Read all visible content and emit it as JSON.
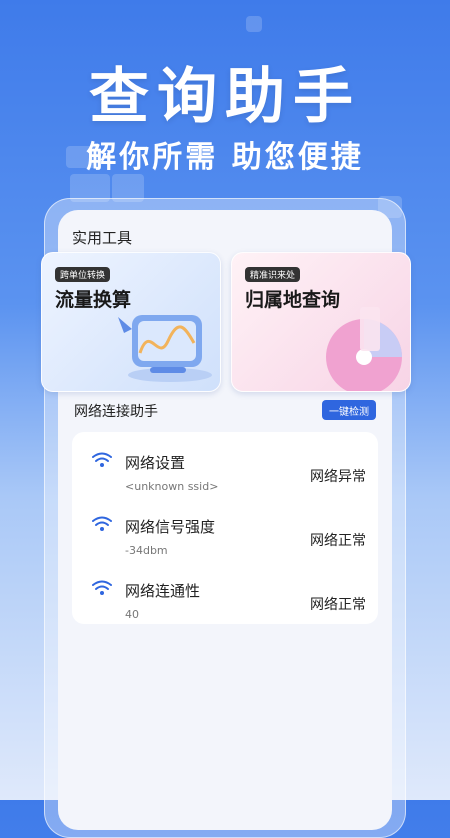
{
  "hero": {
    "title": "查询助手",
    "subtitle": "解你所需 助您便捷"
  },
  "tools": {
    "section_title": "实用工具",
    "cards": [
      {
        "tag": "跨单位转换",
        "title": "流量换算"
      },
      {
        "tag": "精准识来处",
        "title": "归属地查询"
      }
    ]
  },
  "network": {
    "section_title": "网络连接助手",
    "detect_button": "一键检测",
    "items": [
      {
        "name": "网络设置",
        "value": "<unknown ssid>",
        "status": "网络异常"
      },
      {
        "name": "网络信号强度",
        "value": "-34dbm",
        "status": "网络正常"
      },
      {
        "name": "网络连通性",
        "value": "40",
        "status": "网络正常"
      }
    ]
  },
  "colors": {
    "accent": "#2f66df",
    "wifi_icon": "#2f66df"
  }
}
